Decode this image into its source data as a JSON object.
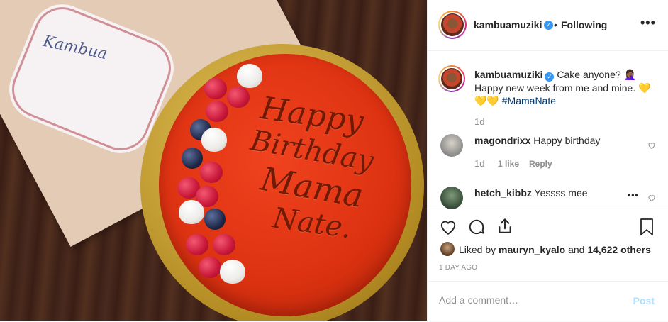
{
  "post": {
    "image_alt": "Birthday cake photo",
    "tag_text": "Kambua",
    "cake_lines": [
      "Happy",
      "Birthday",
      "Mama",
      "Nate."
    ]
  },
  "header": {
    "username": "kambuamuziki",
    "separator": "•",
    "follow_status": "Following",
    "more_icon": "more-options-icon"
  },
  "caption": {
    "username": "kambuamuziki",
    "text": "Cake anyone? 🤦🏾‍♀️ Happy new week from me and mine. 💛💛💛",
    "hashtag": "#MamaNate",
    "time": "1d"
  },
  "comments": [
    {
      "username": "magondrixx",
      "text": "Happy birthday",
      "time": "1d",
      "likes": "1 like",
      "reply": "Reply"
    },
    {
      "username": "hetch_kibbz",
      "text": "Yessss mee"
    }
  ],
  "actions": {
    "like_icon": "heart-icon",
    "comment_icon": "comment-icon",
    "share_icon": "share-icon",
    "save_icon": "bookmark-icon"
  },
  "likes": {
    "prefix": "Liked by",
    "user": "mauryn_kyalo",
    "and": "and",
    "count": "14,622 others"
  },
  "date": "1 DAY AGO",
  "add_comment": {
    "placeholder": "Add a comment…",
    "post_label": "Post"
  },
  "colors": {
    "link": "#003569",
    "verified": "#3897f0",
    "post_disabled": "#b2dffc",
    "muted": "#8e8e8e"
  }
}
